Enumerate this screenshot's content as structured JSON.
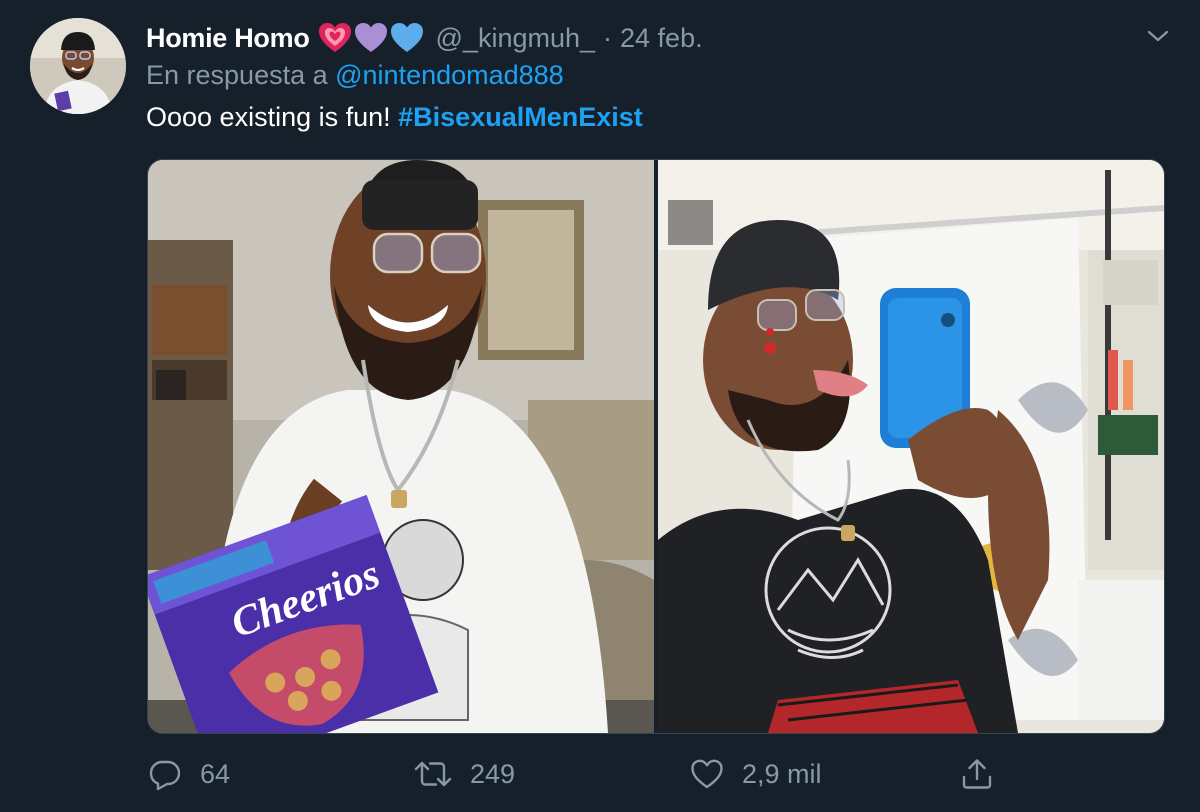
{
  "tweet": {
    "author": {
      "display_name": "Homie Homo",
      "handle": "@_kingmuh_",
      "emojis": [
        "heart-with-ribbon-icon",
        "purple-heart-icon",
        "blue-heart-icon"
      ]
    },
    "separator": "·",
    "date": "24 feb.",
    "reply_prefix": "En respuesta a ",
    "reply_to": "@nintendomad888",
    "text": "Oooo existing is fun! ",
    "hashtag": "#BisexualMenExist",
    "media": {
      "count": 2,
      "left_photo": "man-with-cereal-box-photo",
      "right_photo": "man-mirror-selfie-photo",
      "cereal_box_text": "Cheerios"
    },
    "actions": {
      "reply_count": "64",
      "retweet_count": "249",
      "like_count": "2,9 mil"
    }
  },
  "colors": {
    "background": "#15202b",
    "text": "#ffffff",
    "muted": "#8899a6",
    "link": "#1da1f2",
    "border": "#38444d"
  }
}
